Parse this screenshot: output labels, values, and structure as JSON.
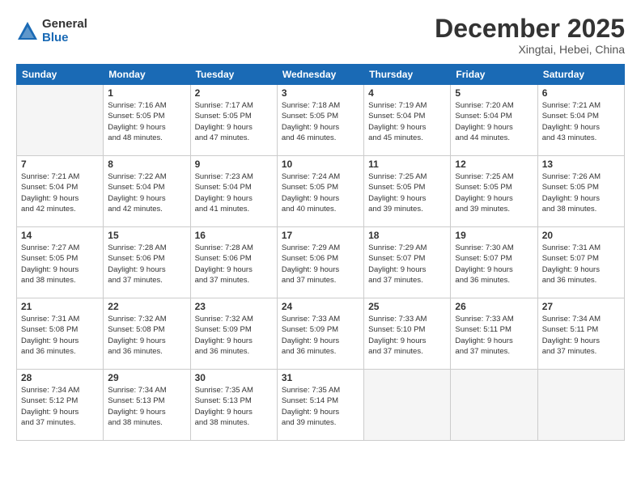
{
  "logo": {
    "general": "General",
    "blue": "Blue"
  },
  "title": "December 2025",
  "location": "Xingtai, Hebei, China",
  "days_of_week": [
    "Sunday",
    "Monday",
    "Tuesday",
    "Wednesday",
    "Thursday",
    "Friday",
    "Saturday"
  ],
  "weeks": [
    [
      {
        "day": "",
        "info": ""
      },
      {
        "day": "1",
        "info": "Sunrise: 7:16 AM\nSunset: 5:05 PM\nDaylight: 9 hours\nand 48 minutes."
      },
      {
        "day": "2",
        "info": "Sunrise: 7:17 AM\nSunset: 5:05 PM\nDaylight: 9 hours\nand 47 minutes."
      },
      {
        "day": "3",
        "info": "Sunrise: 7:18 AM\nSunset: 5:05 PM\nDaylight: 9 hours\nand 46 minutes."
      },
      {
        "day": "4",
        "info": "Sunrise: 7:19 AM\nSunset: 5:04 PM\nDaylight: 9 hours\nand 45 minutes."
      },
      {
        "day": "5",
        "info": "Sunrise: 7:20 AM\nSunset: 5:04 PM\nDaylight: 9 hours\nand 44 minutes."
      },
      {
        "day": "6",
        "info": "Sunrise: 7:21 AM\nSunset: 5:04 PM\nDaylight: 9 hours\nand 43 minutes."
      }
    ],
    [
      {
        "day": "7",
        "info": "Sunrise: 7:21 AM\nSunset: 5:04 PM\nDaylight: 9 hours\nand 42 minutes."
      },
      {
        "day": "8",
        "info": "Sunrise: 7:22 AM\nSunset: 5:04 PM\nDaylight: 9 hours\nand 42 minutes."
      },
      {
        "day": "9",
        "info": "Sunrise: 7:23 AM\nSunset: 5:04 PM\nDaylight: 9 hours\nand 41 minutes."
      },
      {
        "day": "10",
        "info": "Sunrise: 7:24 AM\nSunset: 5:05 PM\nDaylight: 9 hours\nand 40 minutes."
      },
      {
        "day": "11",
        "info": "Sunrise: 7:25 AM\nSunset: 5:05 PM\nDaylight: 9 hours\nand 39 minutes."
      },
      {
        "day": "12",
        "info": "Sunrise: 7:25 AM\nSunset: 5:05 PM\nDaylight: 9 hours\nand 39 minutes."
      },
      {
        "day": "13",
        "info": "Sunrise: 7:26 AM\nSunset: 5:05 PM\nDaylight: 9 hours\nand 38 minutes."
      }
    ],
    [
      {
        "day": "14",
        "info": "Sunrise: 7:27 AM\nSunset: 5:05 PM\nDaylight: 9 hours\nand 38 minutes."
      },
      {
        "day": "15",
        "info": "Sunrise: 7:28 AM\nSunset: 5:06 PM\nDaylight: 9 hours\nand 37 minutes."
      },
      {
        "day": "16",
        "info": "Sunrise: 7:28 AM\nSunset: 5:06 PM\nDaylight: 9 hours\nand 37 minutes."
      },
      {
        "day": "17",
        "info": "Sunrise: 7:29 AM\nSunset: 5:06 PM\nDaylight: 9 hours\nand 37 minutes."
      },
      {
        "day": "18",
        "info": "Sunrise: 7:29 AM\nSunset: 5:07 PM\nDaylight: 9 hours\nand 37 minutes."
      },
      {
        "day": "19",
        "info": "Sunrise: 7:30 AM\nSunset: 5:07 PM\nDaylight: 9 hours\nand 36 minutes."
      },
      {
        "day": "20",
        "info": "Sunrise: 7:31 AM\nSunset: 5:07 PM\nDaylight: 9 hours\nand 36 minutes."
      }
    ],
    [
      {
        "day": "21",
        "info": "Sunrise: 7:31 AM\nSunset: 5:08 PM\nDaylight: 9 hours\nand 36 minutes."
      },
      {
        "day": "22",
        "info": "Sunrise: 7:32 AM\nSunset: 5:08 PM\nDaylight: 9 hours\nand 36 minutes."
      },
      {
        "day": "23",
        "info": "Sunrise: 7:32 AM\nSunset: 5:09 PM\nDaylight: 9 hours\nand 36 minutes."
      },
      {
        "day": "24",
        "info": "Sunrise: 7:33 AM\nSunset: 5:09 PM\nDaylight: 9 hours\nand 36 minutes."
      },
      {
        "day": "25",
        "info": "Sunrise: 7:33 AM\nSunset: 5:10 PM\nDaylight: 9 hours\nand 37 minutes."
      },
      {
        "day": "26",
        "info": "Sunrise: 7:33 AM\nSunset: 5:11 PM\nDaylight: 9 hours\nand 37 minutes."
      },
      {
        "day": "27",
        "info": "Sunrise: 7:34 AM\nSunset: 5:11 PM\nDaylight: 9 hours\nand 37 minutes."
      }
    ],
    [
      {
        "day": "28",
        "info": "Sunrise: 7:34 AM\nSunset: 5:12 PM\nDaylight: 9 hours\nand 37 minutes."
      },
      {
        "day": "29",
        "info": "Sunrise: 7:34 AM\nSunset: 5:13 PM\nDaylight: 9 hours\nand 38 minutes."
      },
      {
        "day": "30",
        "info": "Sunrise: 7:35 AM\nSunset: 5:13 PM\nDaylight: 9 hours\nand 38 minutes."
      },
      {
        "day": "31",
        "info": "Sunrise: 7:35 AM\nSunset: 5:14 PM\nDaylight: 9 hours\nand 39 minutes."
      },
      {
        "day": "",
        "info": ""
      },
      {
        "day": "",
        "info": ""
      },
      {
        "day": "",
        "info": ""
      }
    ]
  ]
}
